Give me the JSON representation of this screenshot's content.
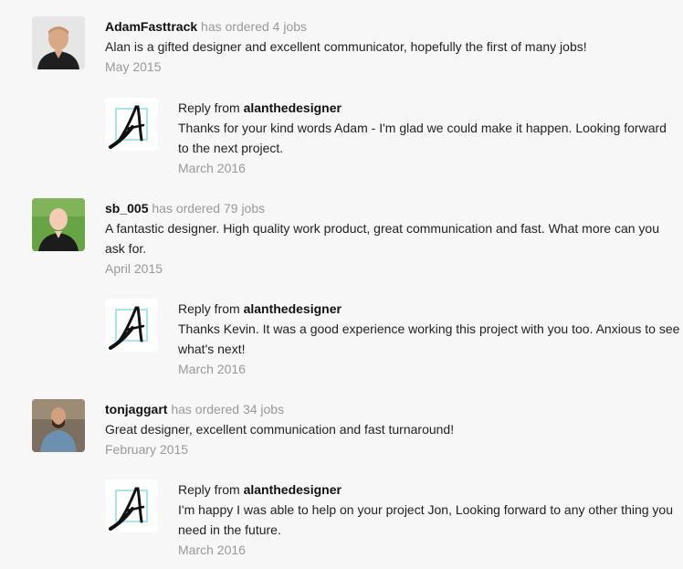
{
  "reviews": [
    {
      "user": "AdamFasttrack",
      "ordered": "has ordered 4 jobs",
      "text": "Alan is a gifted designer and excellent communicator, hopefully the first of many jobs!",
      "date": "May 2015",
      "avatar_bg": "#e4e4e4",
      "reply": {
        "prefix": "Reply from",
        "name": "alanthedesigner",
        "text": "Thanks for your kind words Adam - I'm glad we could make it happen. Looking forward to the next project.",
        "date": "March 2016"
      }
    },
    {
      "user": "sb_005",
      "ordered": "has ordered 79 jobs",
      "text": "A fantastic designer. High quality work product, great communication and fast. What more can you ask for.",
      "date": "April 2015",
      "avatar_bg": "#5c9a3c",
      "reply": {
        "prefix": "Reply from",
        "name": "alanthedesigner",
        "text": "Thanks Kevin. It was a good experience working this project with you too. Anxious to see what's next!",
        "date": "March 2016"
      }
    },
    {
      "user": "tonjaggart",
      "ordered": "has ordered 34 jobs",
      "text": "Great designer, excellent communication and fast turnaround!",
      "date": "February 2015",
      "avatar_bg": "#8a7a66",
      "reply": {
        "prefix": "Reply from",
        "name": "alanthedesigner",
        "text": "I'm happy I was able to help on your project Jon, Looking forward to any other thing you need in the future.",
        "date": "March 2016"
      }
    }
  ]
}
